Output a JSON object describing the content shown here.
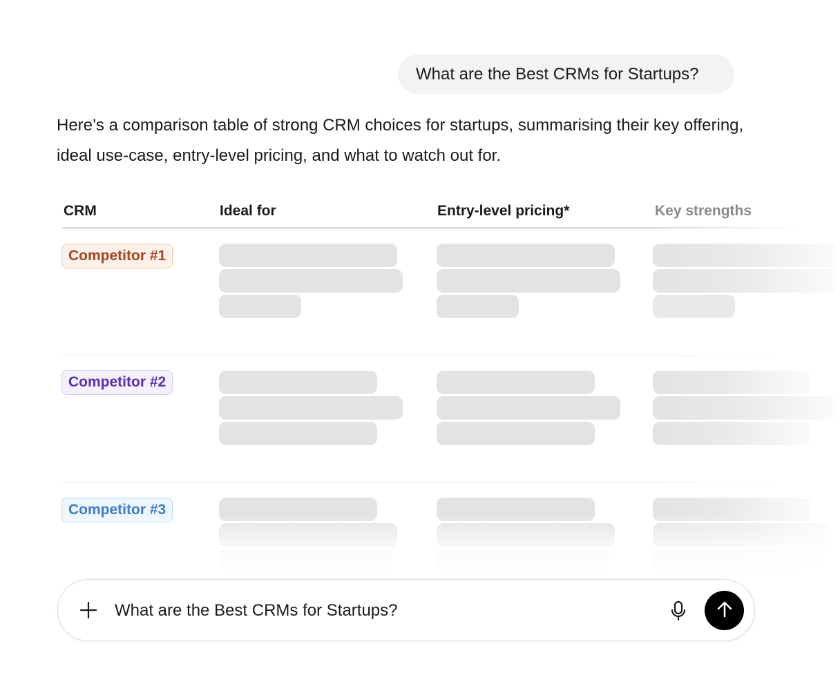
{
  "conversation": {
    "user_message": "What are the Best CRMs for Startups?",
    "assistant_intro": "Here’s a comparison table of strong CRM choices for startups, summarising their key offering, ideal use-case, entry-level pricing, and what to watch out for."
  },
  "table": {
    "headers": {
      "crm": "CRM",
      "ideal_for": "Ideal for",
      "pricing": "Entry-level pricing*",
      "strengths": "Key strengths"
    },
    "rows": [
      {
        "name": "Competitor #1",
        "color": "#a8431f",
        "background": "#fdf2e9",
        "border": "#f3c9a4"
      },
      {
        "name": "Competitor #2",
        "color": "#5b2eb0",
        "background": "#f4f0fd",
        "border": "#d6c9f3"
      },
      {
        "name": "Competitor #3",
        "color": "#3f7cc6",
        "background": "#eef6fd",
        "border": "#b9d8f3"
      }
    ],
    "loading_state": "skeleton"
  },
  "composer": {
    "input_value": "What are the Best CRMs for Startups?",
    "attach_icon": "plus-icon",
    "voice_icon": "microphone-icon",
    "send_icon": "arrow-up-icon"
  },
  "colors": {
    "skeleton": "#e3e3e3",
    "send_button": "#000000",
    "user_bubble": "#f3f3f3"
  }
}
